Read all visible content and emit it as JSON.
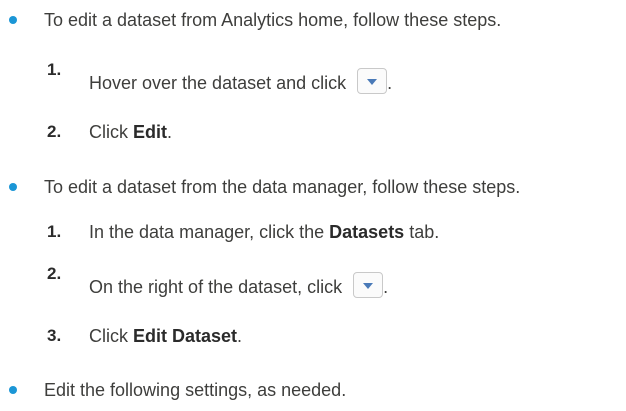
{
  "bullets": [
    {
      "text": "To edit a dataset from Analytics home, follow these steps."
    },
    {
      "text": "To edit a dataset from the data manager, follow these steps."
    },
    {
      "text": "Edit the following settings, as needed."
    }
  ],
  "steps_home": [
    {
      "num": "1.",
      "pre": "Hover over the dataset and click",
      "post": "."
    },
    {
      "num": "2.",
      "pre": "Click ",
      "bold": "Edit",
      "post": "."
    }
  ],
  "steps_manager": [
    {
      "num": "1.",
      "pre": "In the data manager, click the ",
      "bold": "Datasets",
      "post": " tab."
    },
    {
      "num": "2.",
      "pre": "On the right of the dataset, click",
      "post": "."
    },
    {
      "num": "3.",
      "pre": "Click ",
      "bold": "Edit Dataset",
      "post": "."
    }
  ],
  "icons": {
    "dropdown": "chevron-down-icon",
    "bullet": "bullet-dot-icon"
  },
  "colors": {
    "bullet": "#1b96d6",
    "text": "#3e3e3c",
    "dropdown_arrow": "#4a7ab8"
  }
}
